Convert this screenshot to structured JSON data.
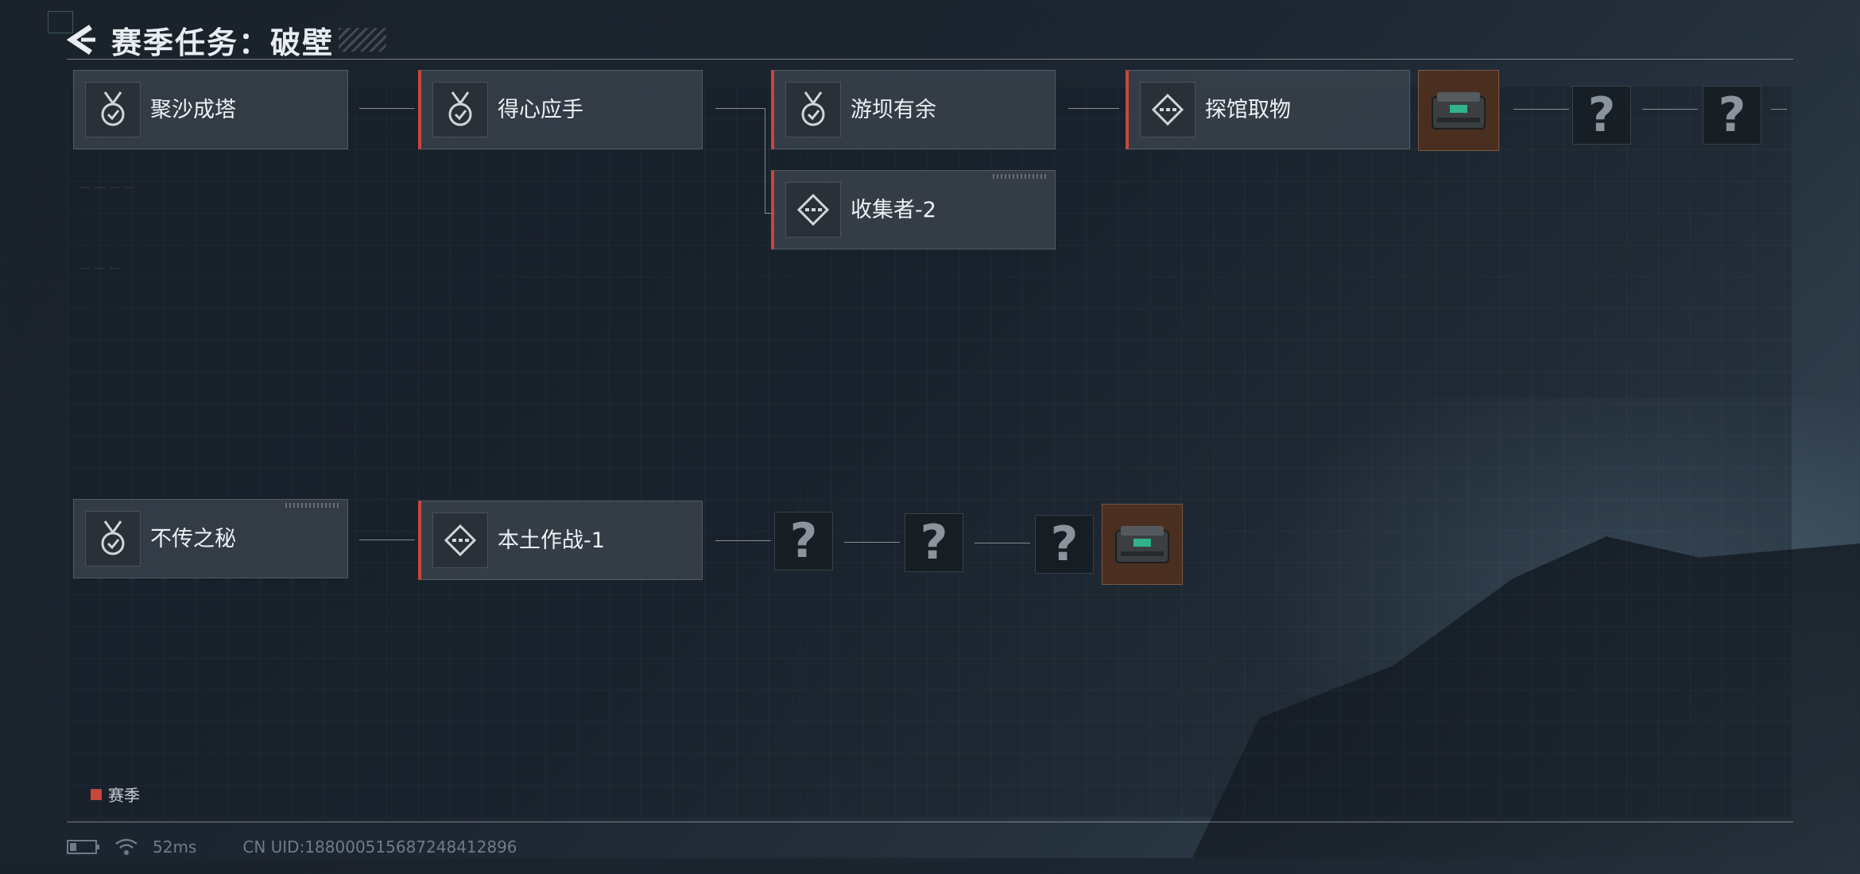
{
  "header": {
    "title": "赛季任务：破壁"
  },
  "row1": {
    "tasks": [
      {
        "label": "聚沙成塔",
        "icon": "medal-check-icon",
        "season": false
      },
      {
        "label": "得心应手",
        "icon": "medal-check-icon",
        "season": true
      },
      {
        "label": "游坝有余",
        "icon": "medal-check-icon",
        "season": true
      },
      {
        "label": "探馆取物",
        "icon": "diamond-dots-icon",
        "season": true
      }
    ],
    "branch": {
      "label": "收集者-2",
      "icon": "diamond-dots-icon",
      "season": true
    },
    "unknown": [
      "?",
      "?"
    ]
  },
  "row2": {
    "tasks": [
      {
        "label": "不传之秘",
        "icon": "medal-check-icon",
        "season": false
      },
      {
        "label": "本土作战-1",
        "icon": "diamond-dots-icon",
        "season": true
      }
    ],
    "unknown": [
      "?",
      "?",
      "?"
    ]
  },
  "legend": {
    "label": "赛季",
    "color": "#c8473d"
  },
  "status": {
    "ping": "52ms",
    "uid": "CN UID:1880005156872484128​96"
  }
}
